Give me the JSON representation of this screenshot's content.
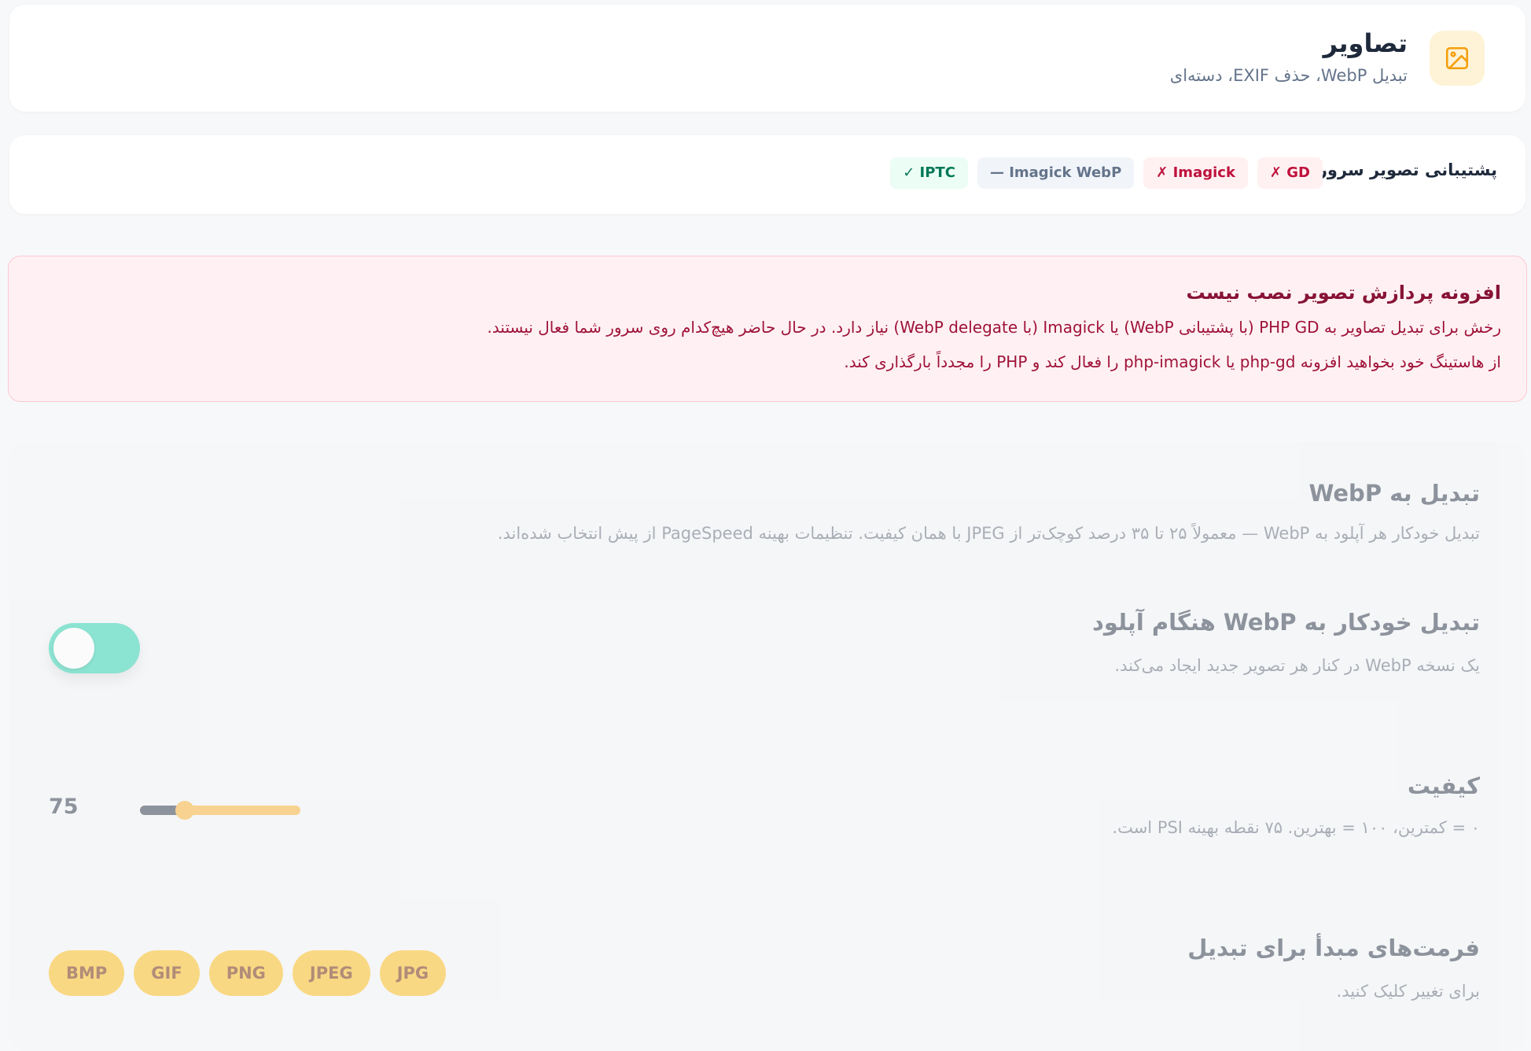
{
  "header": {
    "title": "تصاویر",
    "subtitle": "تبدیل WebP، حذف EXIF، دسته‌ای",
    "icon": "image-icon",
    "icon_color": "#f59e0b"
  },
  "support": {
    "label": "پشتیبانی تصویر سرور:",
    "badges": [
      {
        "text": "✗ GD",
        "status": "missing"
      },
      {
        "text": "✗ Imagick",
        "status": "missing"
      },
      {
        "text": "— Imagick WebP",
        "status": "unknown"
      },
      {
        "text": "✓ IPTC",
        "status": "ok"
      }
    ]
  },
  "alert": {
    "title": "افزونه پردازش تصویر نصب نیست",
    "line1": "رخش برای تبدیل تصاویر به PHP GD (با پشتیبانی WebP) یا Imagick (با WebP delegate) نیاز دارد. در حال حاضر هیچ‌کدام روی سرور شما فعال نیستند.",
    "line2": "از هاستینگ خود بخواهید افزونه php-gd یا php-imagick را فعال کند و PHP را مجدداً بارگذاری کند."
  },
  "webp": {
    "title": "تبدیل به WebP",
    "desc": "تبدیل خودکار هر آپلود به WebP — معمولاً ۲۵ تا ۳۵ درصد کوچک‌تر از JPEG با همان کیفیت. تنظیمات بهینه PageSpeed از پیش انتخاب شده‌اند."
  },
  "auto_convert": {
    "title": "تبدیل خودکار به WebP هنگام آپلود",
    "desc": "یک نسخه WebP در کنار هر تصویر جدید ایجاد می‌کند.",
    "enabled": true
  },
  "quality": {
    "title": "کیفیت",
    "desc": "۰ = کمترین، ۱۰۰ = بهترین. ۷۵ نقطه بهینه PSI است.",
    "value": "75",
    "slider_fraction": 0.28
  },
  "formats": {
    "title": "فرمت‌های مبدأ برای تبدیل",
    "desc": "برای تغییر کلیک کنید.",
    "chips": [
      "BMP",
      "GIF",
      "PNG",
      "JPEG",
      "JPG"
    ]
  },
  "colors": {
    "accent": "#f59e0b",
    "toggle_on": "#34d3b0",
    "danger": "#be123c",
    "success": "#047857"
  }
}
